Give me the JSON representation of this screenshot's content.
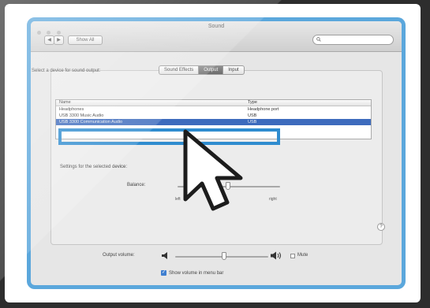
{
  "window": {
    "title": "Sound"
  },
  "toolbar": {
    "back_label": "◀",
    "forward_label": "▶",
    "show_all_label": "Show All",
    "search_placeholder": ""
  },
  "tabs": [
    {
      "label": "Sound Effects",
      "active": false
    },
    {
      "label": "Output",
      "active": true
    },
    {
      "label": "Input",
      "active": false
    }
  ],
  "device_list": {
    "heading": "Select a device for sound output:",
    "columns": [
      "Name",
      "Type"
    ],
    "rows": [
      {
        "name": "Headphones",
        "type": "Headphone port",
        "selected": false
      },
      {
        "name": "USB 3300 Music Audio",
        "type": "USB",
        "selected": false
      },
      {
        "name": "USB 3300 Communication Audio",
        "type": "USB",
        "selected": true
      }
    ]
  },
  "settings": {
    "heading": "Settings for the selected device:",
    "balance_label": "Balance:",
    "balance_left": "left",
    "balance_right": "right",
    "balance_value": 0.5
  },
  "help_label": "?",
  "output_volume": {
    "label": "Output volume:",
    "level": 0.48,
    "mute_label": "Mute",
    "muted": false
  },
  "menu_bar_option": {
    "label": "Show volume in menu bar",
    "checked": true
  },
  "colors": {
    "frame": "#5ba7dc",
    "highlight": "#2f8ccf",
    "selection": "#3d6bbd",
    "background": "#2d2d2d"
  },
  "icons": [
    "search-icon",
    "speaker-low-icon",
    "speaker-high-icon",
    "mouse-pointer-icon",
    "checkmark-icon"
  ]
}
